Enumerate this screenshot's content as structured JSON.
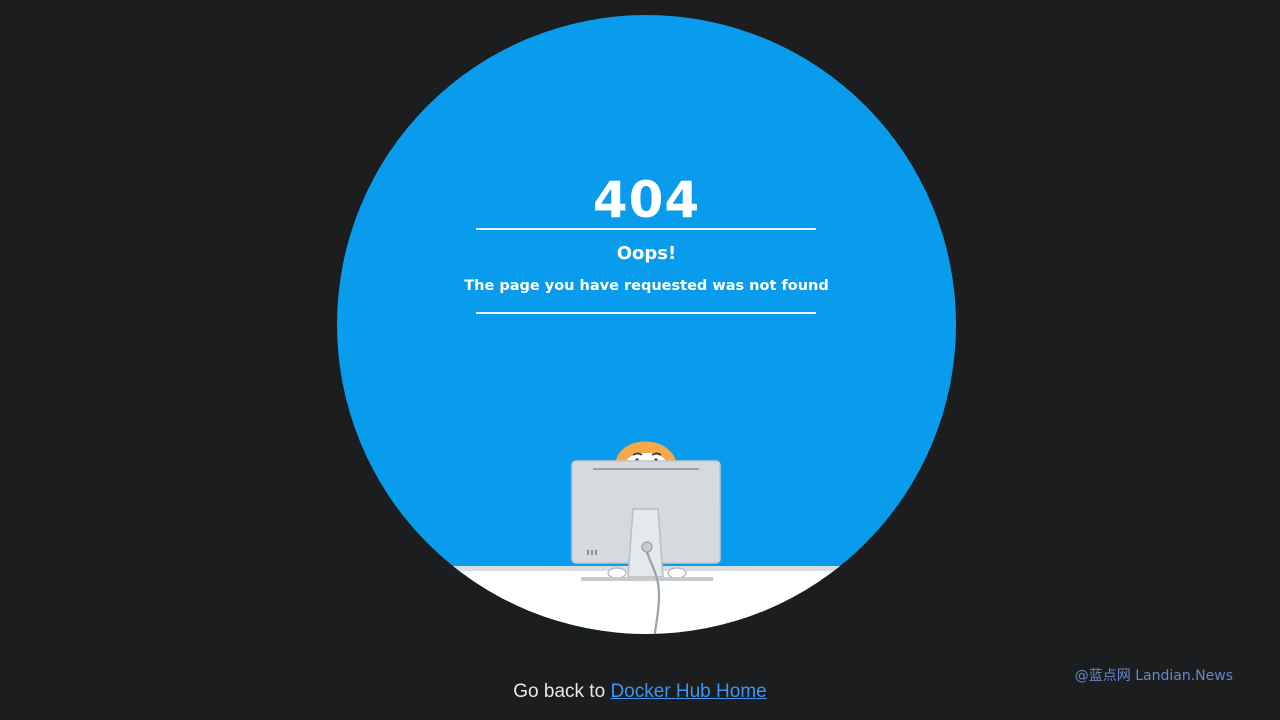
{
  "error": {
    "code": "404",
    "title": "Oops!",
    "message": "The page you have requested was not found"
  },
  "footer": {
    "prefix": "Go back to ",
    "link_label": "Docker Hub Home"
  },
  "watermark": {
    "text": "@蓝点网 Landian.News"
  },
  "colors": {
    "background": "#1c1d1f",
    "circle": "#0a9cec",
    "link": "#3d95ef"
  },
  "illustration": {
    "icon": "person-behind-monitor-illustration"
  }
}
